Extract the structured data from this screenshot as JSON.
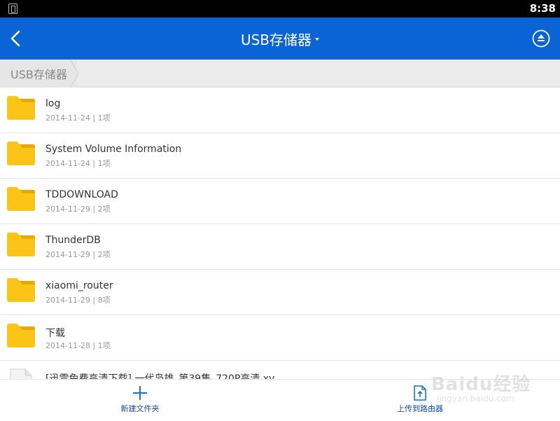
{
  "statusbar": {
    "time": "8:38",
    "icon": "sim-card-icon"
  },
  "appbar": {
    "title": "USB存储器",
    "back_icon": "back-arrow-icon",
    "dropdown_icon": "caret-down-icon",
    "eject_icon": "eject-icon",
    "color": "#0a64d6"
  },
  "breadcrumb": {
    "items": [
      {
        "label": "USB存储器"
      }
    ]
  },
  "list": {
    "items": [
      {
        "type": "folder",
        "name": "log",
        "meta": "2014-11-24 | 1项"
      },
      {
        "type": "folder",
        "name": "System Volume Information",
        "meta": "2014-11-24 | 1项"
      },
      {
        "type": "folder",
        "name": "TDDOWNLOAD",
        "meta": "2014-11-29 | 2项"
      },
      {
        "type": "folder",
        "name": "ThunderDB",
        "meta": "2014-11-29 | 2项"
      },
      {
        "type": "folder",
        "name": "xiaomi_router",
        "meta": "2014-11-29 | 8项"
      },
      {
        "type": "folder",
        "name": "下载",
        "meta": "2014-11-28 | 1项"
      },
      {
        "type": "file",
        "name": "[迅雷免费高清下载].一代枭雄_第39集_720P高清.xv",
        "meta": ""
      }
    ]
  },
  "bottombar": {
    "new_folder_label": "新建文件夹",
    "upload_label": "上传到路由器",
    "new_folder_icon": "plus-icon",
    "upload_icon": "upload-file-icon"
  },
  "watermark": {
    "main": "Baidu经验",
    "sub": "jingyan.baidu.com"
  },
  "colors": {
    "folder": "#fbc416",
    "folder_tab": "#e8a800",
    "accent": "#0a64d6"
  }
}
